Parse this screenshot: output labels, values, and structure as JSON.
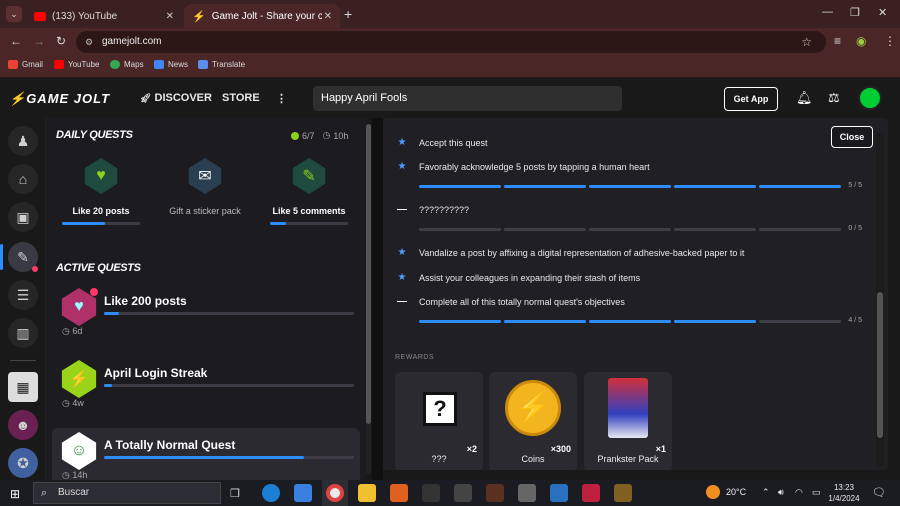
{
  "browser": {
    "tabs": [
      {
        "title": "(133) YouTube",
        "color": "#ff0000"
      },
      {
        "title": "Game Jolt - Share your creations",
        "color": "#ccff00"
      }
    ],
    "url": "gamejolt.com",
    "bookmarks": [
      "Gmail",
      "YouTube",
      "Maps",
      "News",
      "Translate"
    ]
  },
  "site": {
    "logo": "GAME JOLT",
    "nav": {
      "discover": "DISCOVER",
      "store": "STORE"
    },
    "search_value": "Happy April Fools",
    "get_app": "Get App"
  },
  "quests": {
    "daily_title": "DAILY QUESTS",
    "daily_count": "6/7",
    "daily_timer": "10h",
    "daily": [
      {
        "label": "Like 20 posts",
        "progress": 0.55,
        "icon": "heart-phone-icon",
        "color": "#1f4a3e"
      },
      {
        "label": "Gift a sticker pack",
        "progress": null,
        "icon": "sticker-gift-icon",
        "color": "#2a3f52"
      },
      {
        "label": "Like 5 comments",
        "progress": 0.2,
        "icon": "comment-heart-icon",
        "color": "#1f4a3e"
      }
    ],
    "active_title": "ACTIVE QUESTS",
    "active": [
      {
        "name": "Like 200 posts",
        "progress": 0.06,
        "time": "6d",
        "icon": "heart-gem-icon",
        "color": "#b0306a"
      },
      {
        "name": "April Login Streak",
        "progress": 0.03,
        "time": "4w",
        "icon": "lightning-icon",
        "color": "#9ad41a"
      },
      {
        "name": "A Totally Normal Quest",
        "progress": 0.8,
        "time": "14h",
        "icon": "creature-icon",
        "color": "#ffffff"
      }
    ]
  },
  "detail": {
    "close": "Close",
    "objectives": [
      {
        "text": "Accept this quest",
        "marker": "star"
      },
      {
        "text": "Favorably acknowledge 5 posts by tapping a human heart",
        "marker": "star",
        "bar": {
          "segments": 5,
          "filled": 5
        },
        "count": "5 / 5"
      },
      {
        "text": "??????????",
        "marker": "dash",
        "bar": {
          "segments": 5,
          "filled": 0
        },
        "count": "0 / 5"
      },
      {
        "text": "Vandalize a post by affixing a digital representation of adhesive-backed paper to it",
        "marker": "star"
      },
      {
        "text": "Assist your colleagues in expanding their stash of items",
        "marker": "star"
      },
      {
        "text": "Complete all of this totally normal quest's objectives",
        "marker": "dash",
        "bar": {
          "segments": 5,
          "filled": 4
        },
        "count": "4 / 5"
      }
    ],
    "rewards_label": "REWARDS",
    "rewards": [
      {
        "name": "???",
        "qty": "×2",
        "icon": "mystery-box-icon"
      },
      {
        "name": "Coins",
        "qty": "×300",
        "icon": "coin-icon"
      },
      {
        "name": "Prankster Pack",
        "qty": "×1",
        "icon": "sticker-pack-icon"
      }
    ]
  },
  "taskbar": {
    "search": "Buscar",
    "weather": "20°C",
    "time": "13:23",
    "date": "1/4/2024"
  }
}
